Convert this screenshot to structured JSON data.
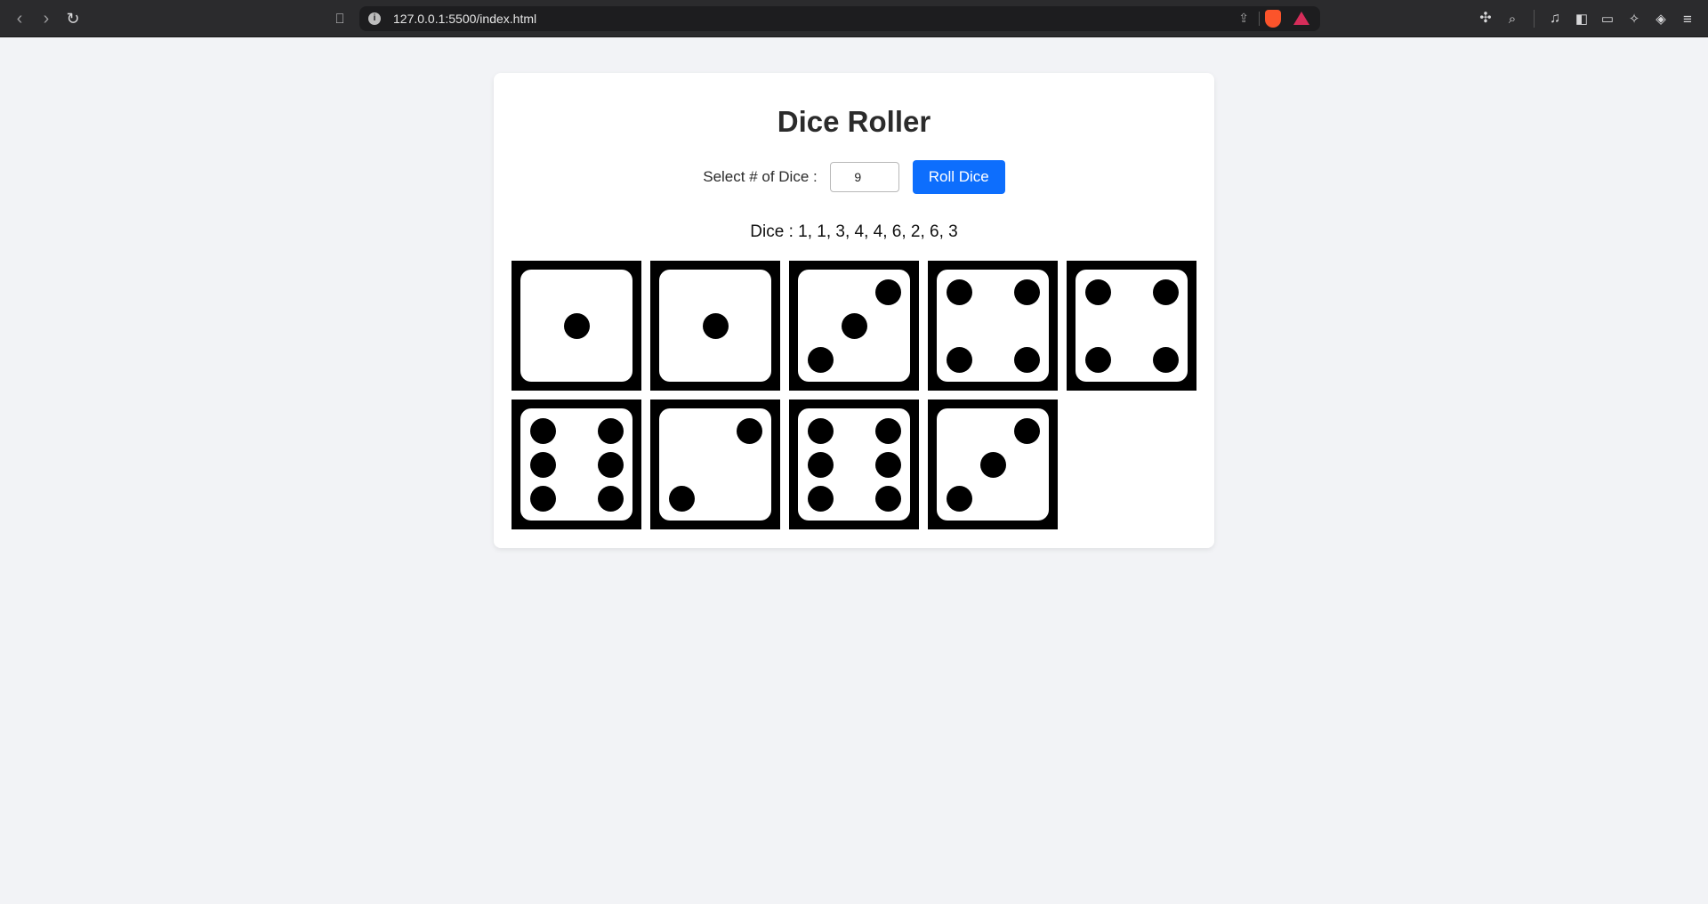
{
  "browser": {
    "url": "127.0.0.1:5500/index.html"
  },
  "app": {
    "title": "Dice Roller",
    "select_label": "Select # of Dice :",
    "dice_count": "9",
    "roll_button": "Roll Dice",
    "result_text": "Dice : 1, 1, 3, 4, 4, 6, 2, 6, 3",
    "dice": [
      1,
      1,
      3,
      4,
      4,
      6,
      2,
      6,
      3
    ]
  }
}
